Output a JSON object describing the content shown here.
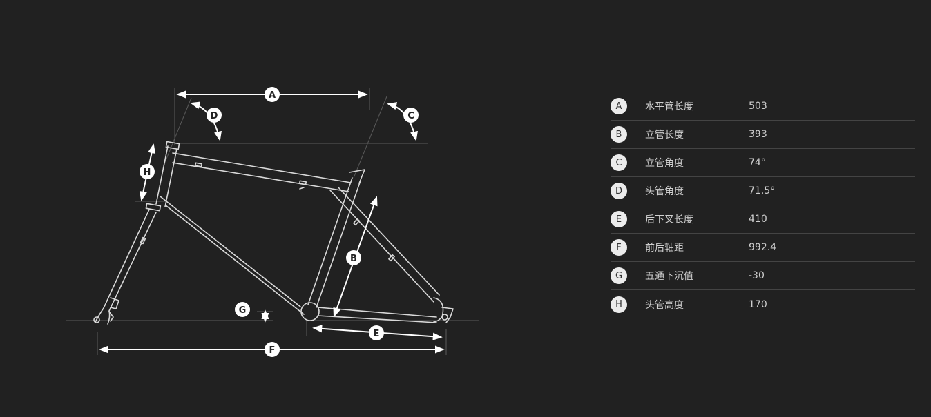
{
  "diagram": {
    "labels": {
      "A": "A",
      "B": "B",
      "C": "C",
      "D": "D",
      "E": "E",
      "F": "F",
      "G": "G",
      "H": "H"
    }
  },
  "specs": [
    {
      "key": "A",
      "name": "水平管长度",
      "value": "503"
    },
    {
      "key": "B",
      "name": "立管长度",
      "value": "393"
    },
    {
      "key": "C",
      "name": "立管角度",
      "value": "74°"
    },
    {
      "key": "D",
      "name": "头管角度",
      "value": "71.5°"
    },
    {
      "key": "E",
      "name": "后下叉长度",
      "value": "410"
    },
    {
      "key": "F",
      "name": "前后轴距",
      "value": "992.4"
    },
    {
      "key": "G",
      "name": "五通下沉值",
      "value": "-30"
    },
    {
      "key": "H",
      "name": "头管高度",
      "value": "170"
    }
  ]
}
